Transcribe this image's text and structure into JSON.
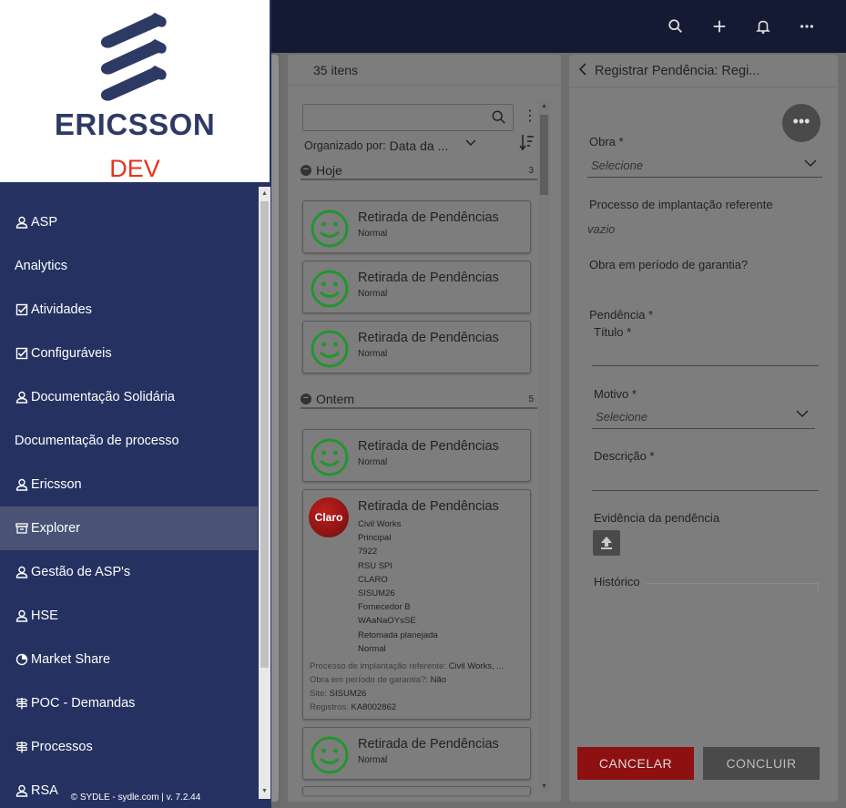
{
  "brand": {
    "name": "ERICSSON",
    "env": "DEV"
  },
  "topbar": {
    "icons": [
      "search-icon",
      "plus-icon",
      "bell-icon",
      "more-icon"
    ]
  },
  "sidebar": {
    "items": [
      {
        "label": "ASP",
        "icon": "person-icon"
      },
      {
        "label": "Analytics",
        "icon": ""
      },
      {
        "label": "Atividades",
        "icon": "checkbox-icon"
      },
      {
        "label": "Configuráveis",
        "icon": "checkbox-icon"
      },
      {
        "label": "Documentação Solidária",
        "icon": "person-icon"
      },
      {
        "label": "Documentação de processo",
        "icon": ""
      },
      {
        "label": "Ericsson",
        "icon": "person-icon"
      },
      {
        "label": "Explorer",
        "icon": "archive-icon"
      },
      {
        "label": "Gestão de ASP's",
        "icon": "person-icon"
      },
      {
        "label": "HSE",
        "icon": "person-icon"
      },
      {
        "label": "Market Share",
        "icon": "pie-icon"
      },
      {
        "label": "POC - Demandas",
        "icon": "signpost-icon"
      },
      {
        "label": "Processos",
        "icon": "signpost-icon"
      },
      {
        "label": "RSA",
        "icon": "person-icon"
      }
    ],
    "footer": "© SYDLE - sydle.com  |  v. 7.2.44"
  },
  "list": {
    "count_label": "35 itens",
    "search": {
      "value": "",
      "placeholder": ""
    },
    "sort_label": "Organizado por:",
    "sort_value": "Data da ...",
    "groups": [
      {
        "label": "Hoje",
        "count": "3"
      },
      {
        "label": "Ontem",
        "count": "5"
      }
    ],
    "cards": [
      {
        "title": "Retirada de Pendências",
        "sub": "Normal"
      },
      {
        "title": "Retirada de Pendências",
        "sub": "Normal"
      },
      {
        "title": "Retirada de Pendências",
        "sub": "Normal"
      },
      {
        "title": "Retirada de Pendências",
        "sub": "Normal"
      },
      {
        "title": "Retirada de Pendências",
        "sub": "Normal"
      }
    ],
    "claro_card": {
      "logo": "Claro",
      "title": "Retirada de Pendências",
      "details": [
        "Civil Works",
        "Principal",
        "7922",
        "RSU SPI",
        "CLARO",
        "SISUM26",
        "Fornecedor B",
        "WAaNaOYsSE",
        "Retomada planejada",
        "Normal"
      ],
      "extra": [
        {
          "key": "Processo de implantação referente:",
          "value": "Civil Works, ..."
        },
        {
          "key": "Obra em período de garantia?:",
          "value": "Não"
        },
        {
          "key": "Site:",
          "value": "SISUM26"
        },
        {
          "key": "Registros:",
          "value": "KA8002862"
        }
      ]
    }
  },
  "form": {
    "title": "Registrar Pendência: Regi...",
    "obra_label": "Obra *",
    "obra_placeholder": "Selecione",
    "processo_label": "Processo de implantação referente",
    "processo_value": "vazio",
    "garantia_label": "Obra em período de garantia?",
    "pendencia_label": "Pendência *",
    "titulo_label": "Título *",
    "motivo_label": "Motivo *",
    "motivo_placeholder": "Selecione",
    "descricao_label": "Descrição *",
    "evidencia_label": "Evidência da pendência",
    "historico_label": "Histórico",
    "cancel": "CANCELAR",
    "conclude": "CONCLUIR"
  }
}
